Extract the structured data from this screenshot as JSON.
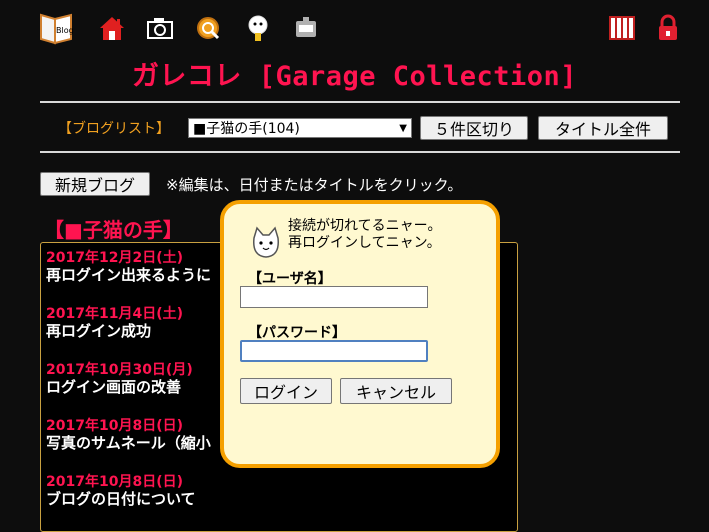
{
  "header": {
    "icons": [
      "blog-icon",
      "home-icon",
      "camera-icon",
      "gear-icon",
      "mascot-icon",
      "robot-icon",
      "gate-icon",
      "lock-icon"
    ],
    "blog_icon_text": "Blog",
    "title": "ガレコレ [Garage Collection]"
  },
  "toolbar": {
    "blog_list_label": "【ブログリスト】",
    "selected_blog": "■子猫の手(104)",
    "five_split_button": "５件区切り",
    "all_titles_button": "タイトル全件"
  },
  "actions": {
    "new_blog_button": "新規ブログ",
    "hint": "※編集は、日付またはタイトルをクリック。"
  },
  "blog": {
    "heading": "【■子猫の手】",
    "entries": [
      {
        "date": "2017年12月2日(土)",
        "title": "再ログイン出来るように"
      },
      {
        "date": "2017年11月4日(土)",
        "title": "再ログイン成功"
      },
      {
        "date": "2017年10月30日(月)",
        "title": "ログイン画面の改善"
      },
      {
        "date": "2017年10月8日(日)",
        "title": "写真のサムネール（縮小"
      },
      {
        "date": "2017年10月8日(日)",
        "title": "ブログの日付について"
      }
    ]
  },
  "login_dialog": {
    "message_line1": "接続が切れてるニャー。",
    "message_line2": "再ログインしてニャン。",
    "username_label": "【ユーザ名】",
    "username_value": "",
    "password_label": "【パスワード】",
    "password_value": "",
    "login_button": "ログイン",
    "cancel_button": "キャンセル"
  },
  "colors": {
    "background": "#0d0d0d",
    "accent_red": "#ff1450",
    "dialog_border": "#f5a000",
    "dialog_background": "#fff9d0",
    "blog_list_label": "#f0a020"
  }
}
